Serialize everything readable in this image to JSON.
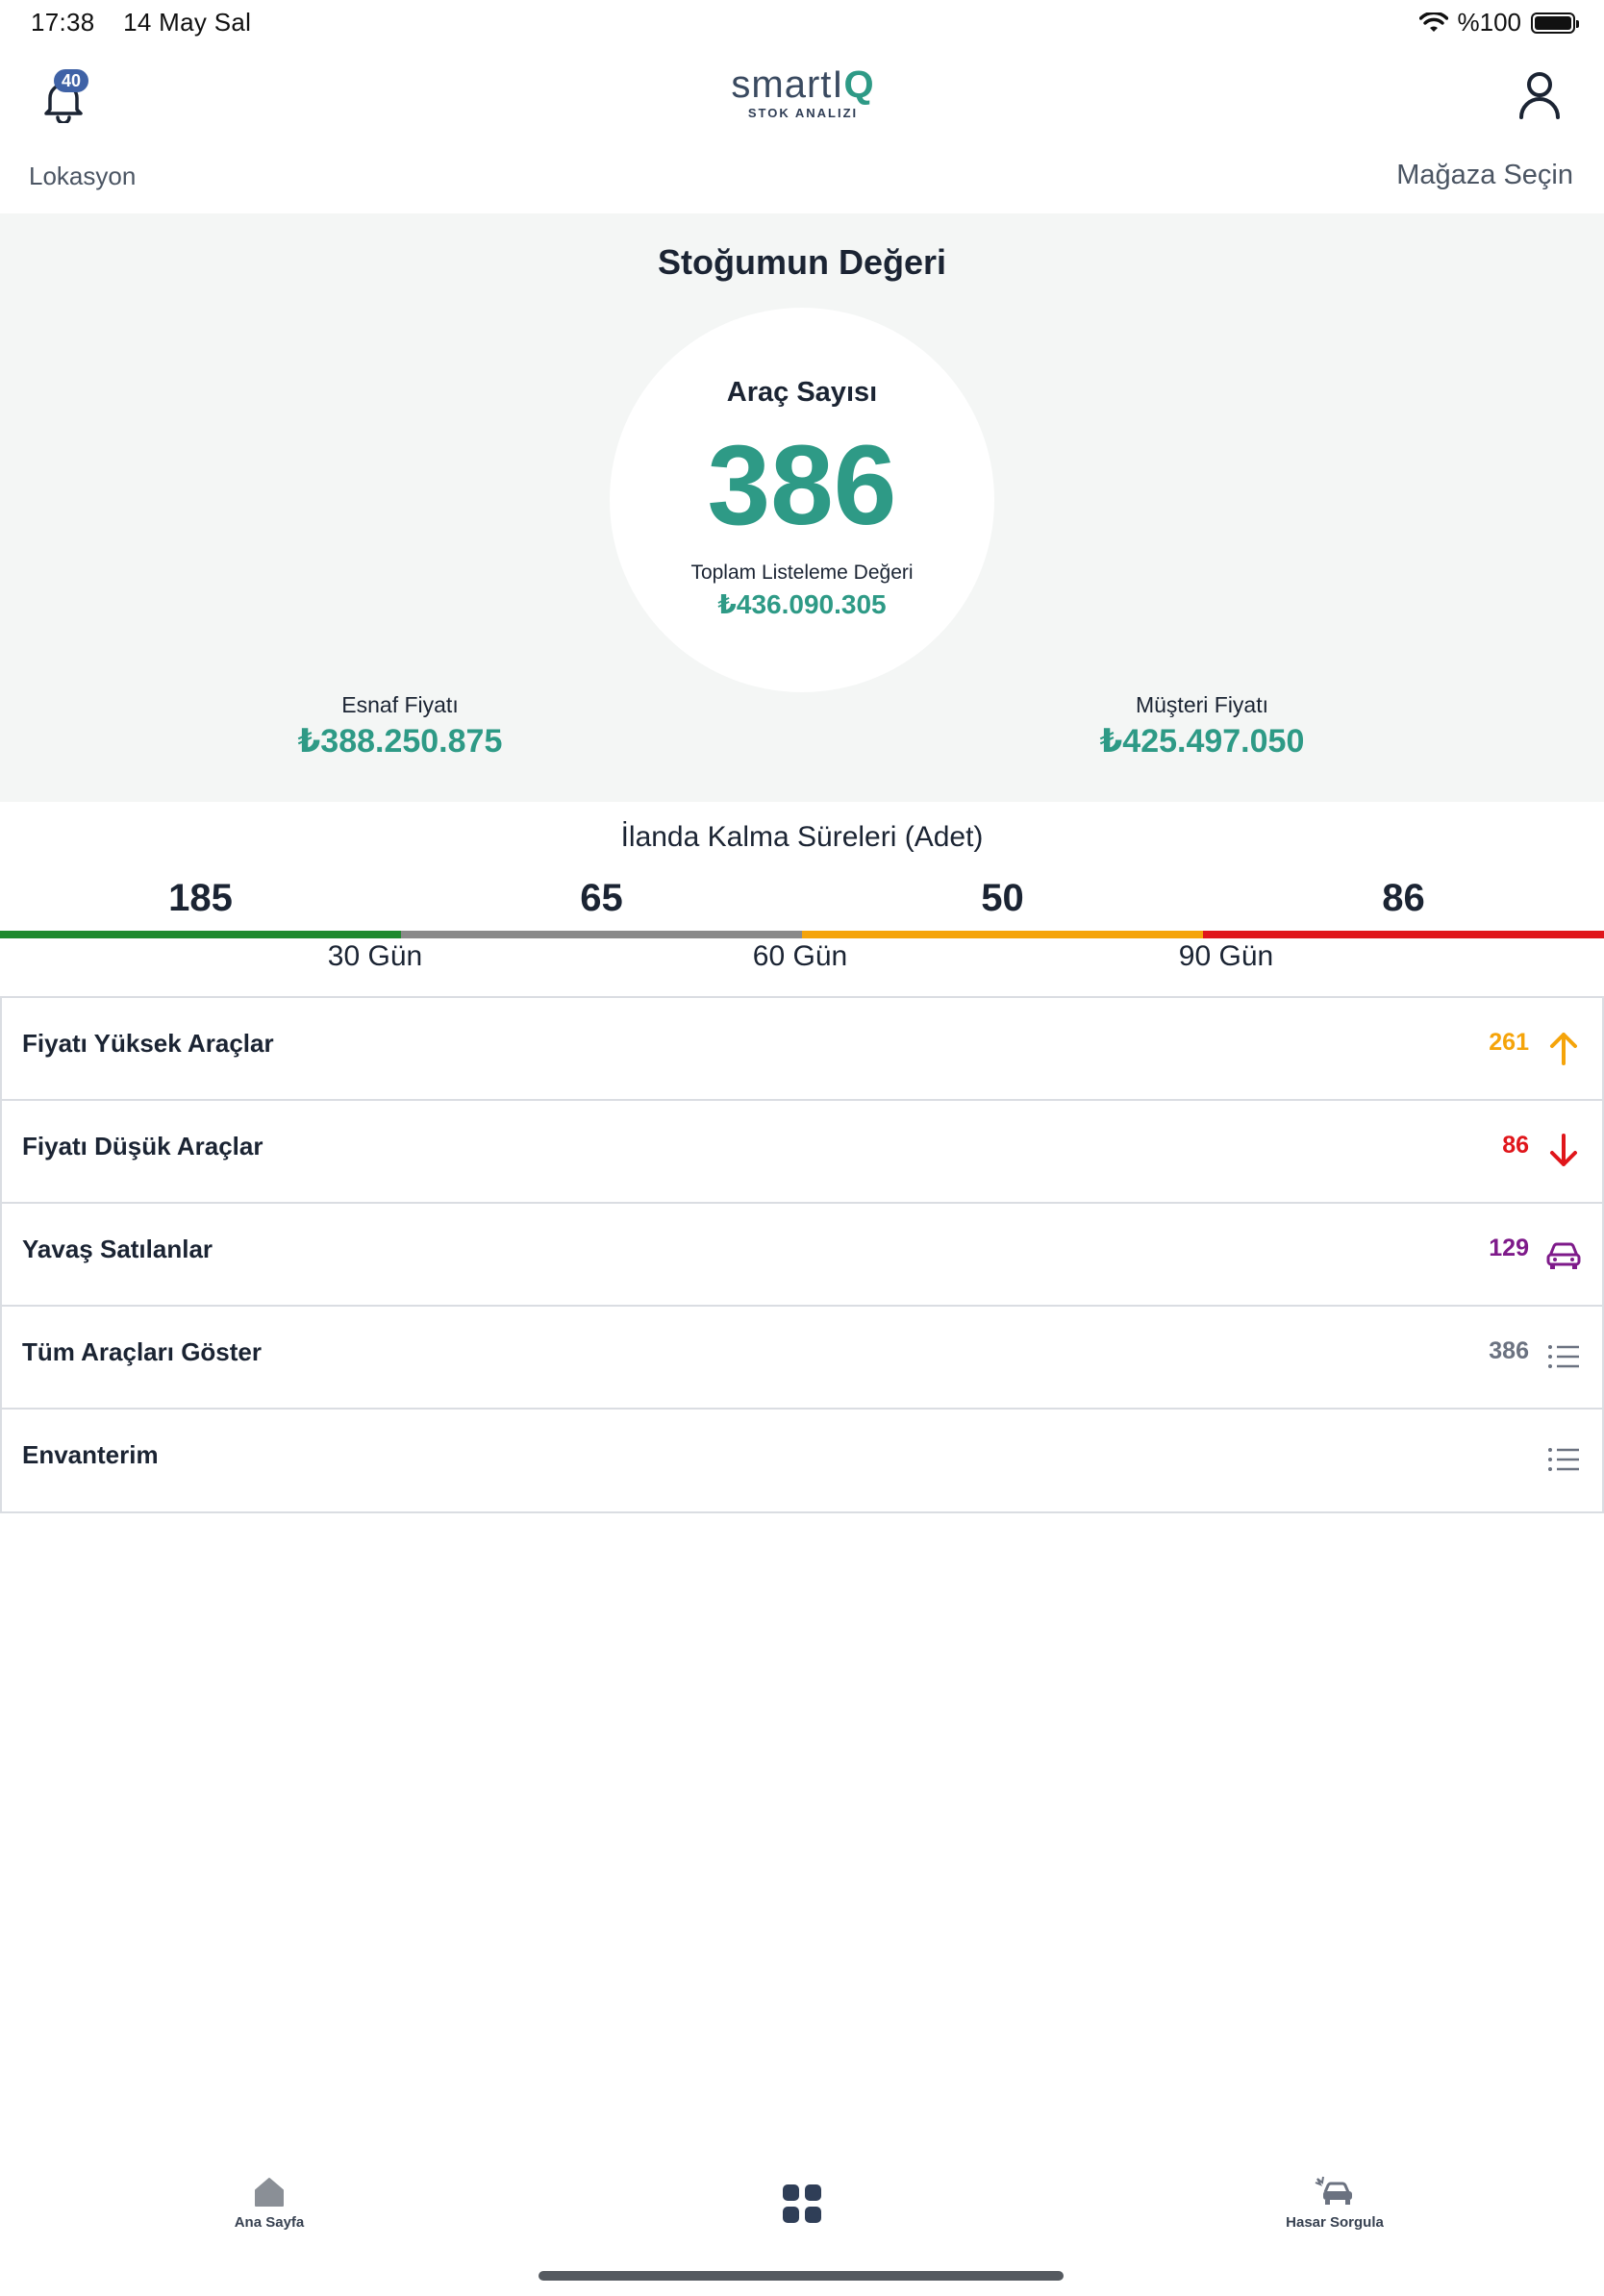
{
  "status_bar": {
    "time": "17:38",
    "date": "14 May Sal",
    "battery": "%100"
  },
  "header": {
    "notification_count": "40",
    "logo_text": "smartI",
    "logo_q": "Q",
    "logo_subtitle": "STOK ANALIZI",
    "location_label": "Lokasyon",
    "store_select_label": "Mağaza Seçin"
  },
  "stock_value": {
    "title": "Stoğumun Değeri",
    "vehicle_count_label": "Araç Sayısı",
    "vehicle_count": "386",
    "total_listing_label": "Toplam Listeleme Değeri",
    "total_listing_value": "₺436.090.305",
    "tradesman_price_label": "Esnaf Fiyatı",
    "tradesman_price_value": "₺388.250.875",
    "customer_price_label": "Müşteri Fiyatı",
    "customer_price_value": "₺425.497.050"
  },
  "listing_duration": {
    "title": "İlanda Kalma Süreleri (Adet)",
    "counts": [
      "185",
      "65",
      "50",
      "86"
    ],
    "colors": [
      "#1f8a2e",
      "#8a8a8a",
      "#f5a40a",
      "#e0161b"
    ],
    "ticks": [
      "30 Gün",
      "60 Gün",
      "90 Gün"
    ]
  },
  "list_items": [
    {
      "label": "Fiyatı Yüksek Araçlar",
      "count": "261",
      "count_color": "#f5a40a",
      "icon": "arrow-up-icon"
    },
    {
      "label": "Fiyatı Düşük Araçlar",
      "count": "86",
      "count_color": "#e0161b",
      "icon": "arrow-down-icon"
    },
    {
      "label": "Yavaş Satılanlar",
      "count": "129",
      "count_color": "#7e1a8a",
      "icon": "car-icon"
    },
    {
      "label": "Tüm Araçları Göster",
      "count": "386",
      "count_color": "#6b7280",
      "icon": "list-icon"
    },
    {
      "label": "Envanterim",
      "count": "",
      "count_color": "#6b7280",
      "icon": "list-icon"
    }
  ],
  "tab_bar": {
    "home_label": "Ana Sayfa",
    "damage_label": "Hasar Sorgula"
  },
  "colors": {
    "accent": "#2e9a86",
    "dark_text": "#1b2433",
    "panel_bg": "#f4f6f5"
  }
}
